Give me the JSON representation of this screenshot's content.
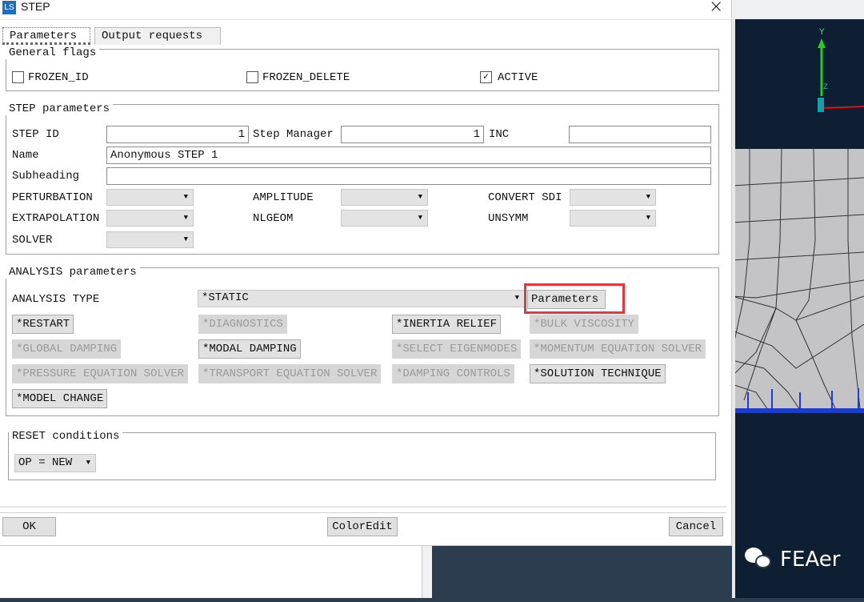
{
  "window": {
    "title": "STEP",
    "app_icon": "app-logo-icon",
    "close_icon": "close-icon"
  },
  "tabs": [
    {
      "label": "Parameters",
      "active": true
    },
    {
      "label": "Output requests",
      "active": false
    }
  ],
  "general_flags": {
    "legend": "General flags",
    "items": [
      {
        "label": "FROZEN_ID",
        "checked": false
      },
      {
        "label": "FROZEN_DELETE",
        "checked": false
      },
      {
        "label": "ACTIVE",
        "checked": true
      }
    ]
  },
  "step_parameters": {
    "legend": "STEP parameters",
    "step_id_label": "STEP ID",
    "step_id_value": "1",
    "step_manager_label": "Step Manager",
    "step_manager_value": "1",
    "inc_label": "INC",
    "inc_value": "",
    "name_label": "Name",
    "name_value": "Anonymous STEP 1",
    "subheading_label": "Subheading",
    "subheading_value": "",
    "perturbation_label": "PERTURBATION",
    "amplitude_label": "AMPLITUDE",
    "convert_sdi_label": "CONVERT SDI",
    "extrapolation_label": "EXTRAPOLATION",
    "nlgeom_label": "NLGEOM",
    "unsymm_label": "UNSYMM",
    "solver_label": "SOLVER"
  },
  "analysis": {
    "legend": "ANALYSIS parameters",
    "type_label": "ANALYSIS TYPE",
    "type_value": "*STATIC",
    "parameters_button": "Parameters",
    "highlight_color": "#e8363a",
    "buttons": [
      {
        "label": "*RESTART",
        "enabled": true
      },
      {
        "label": "*DIAGNOSTICS",
        "enabled": false
      },
      {
        "label": "*INERTIA RELIEF",
        "enabled": true
      },
      {
        "label": "*BULK VISCOSITY",
        "enabled": false
      },
      {
        "label": "*GLOBAL DAMPING",
        "enabled": false
      },
      {
        "label": "*MODAL DAMPING",
        "enabled": true
      },
      {
        "label": "*SELECT EIGENMODES",
        "enabled": false
      },
      {
        "label": "*MOMENTUM EQUATION SOLVER",
        "enabled": false
      },
      {
        "label": "*PRESSURE EQUATION SOLVER",
        "enabled": false
      },
      {
        "label": "*TRANSPORT EQUATION SOLVER",
        "enabled": false
      },
      {
        "label": "*DAMPING CONTROLS",
        "enabled": false
      },
      {
        "label": "*SOLUTION TECHNIQUE",
        "enabled": true
      },
      {
        "label": "*MODEL CHANGE",
        "enabled": true
      }
    ]
  },
  "reset": {
    "legend": "RESET conditions",
    "op_value": "OP = NEW"
  },
  "footer": {
    "ok": "OK",
    "coloredit": "ColorEdit",
    "cancel": "Cancel"
  },
  "viewport": {
    "axis_y": "Y",
    "axis_z": "Z",
    "watermark": "FEAer"
  }
}
